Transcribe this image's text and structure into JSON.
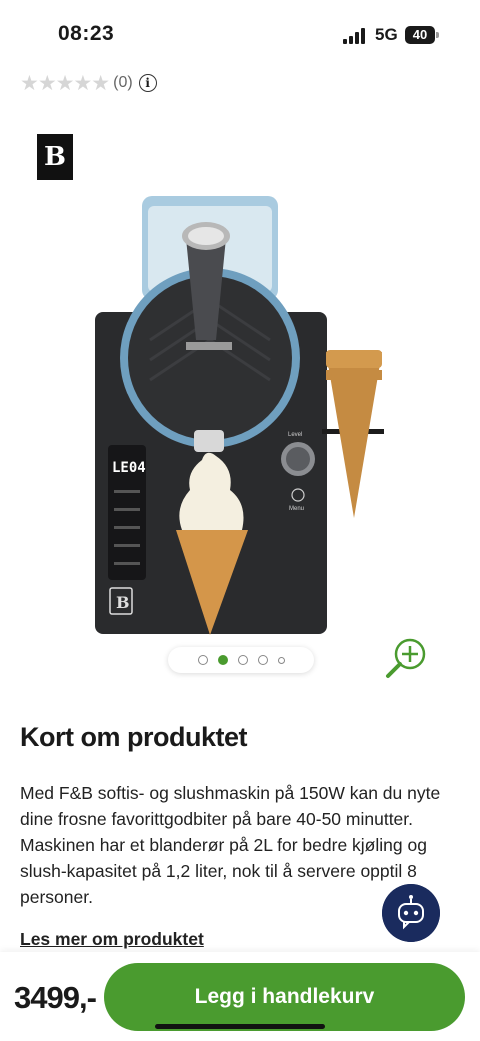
{
  "status_bar": {
    "time": "08:23",
    "network": "5G",
    "battery": "40"
  },
  "rating": {
    "stars": "★★★★★",
    "count": "(0)",
    "info_glyph": "i"
  },
  "gallery": {
    "logo_text": "B",
    "pager": {
      "count": 5,
      "active_index": 1
    },
    "machine": {
      "display": "LE04",
      "dial_label": "Level",
      "menu_label": "Menu",
      "panel_logo": "B"
    }
  },
  "product": {
    "section_title": "Kort om produktet",
    "description": "Med F&B softis- og slushmaskin på 150W kan du nyte dine frosne favorittgodbiter på bare 40-50 minutter. Maskinen har et blanderør på 2L for bedre kjøling og slush-kapasitet på 1,2 liter, nok til å servere opptil 8 personer.",
    "read_more": "Les mer om produktet"
  },
  "purchase": {
    "price": "3499,-",
    "cart_label": "Legg i handlekurv"
  },
  "colors": {
    "accent": "#4a9b2f",
    "chat": "#1a2b5e"
  }
}
